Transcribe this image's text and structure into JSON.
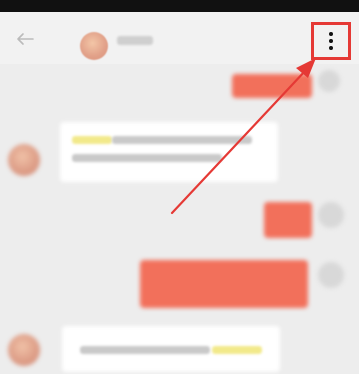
{
  "header": {
    "back_icon": "arrow-left-icon",
    "more_icon": "more-vertical-icon"
  },
  "annotation": {
    "color": "#e53935"
  },
  "colors": {
    "sent_bubble": "#f2705b",
    "received_bubble": "#ffffff",
    "background": "#ededed"
  }
}
